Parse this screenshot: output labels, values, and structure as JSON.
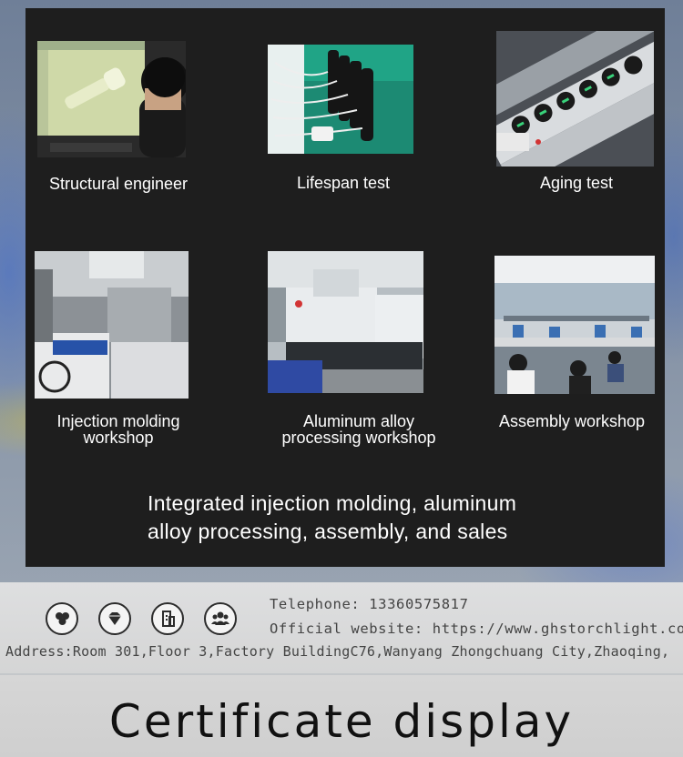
{
  "gallery": {
    "items": [
      {
        "caption": "Structural engineer",
        "icon": "cad-workstation-photo"
      },
      {
        "caption": "Lifespan test",
        "icon": "flashlight-test-photo"
      },
      {
        "caption": "Aging test",
        "icon": "aging-rack-photo"
      },
      {
        "caption": "Injection molding\nworkshop",
        "icon": "injection-machine-photo"
      },
      {
        "caption": "Aluminum alloy\nprocessing workshop",
        "icon": "cnc-machine-photo"
      },
      {
        "caption": "Assembly workshop",
        "icon": "assembly-line-photo"
      }
    ],
    "tagline_line1": "Integrated injection molding, aluminum",
    "tagline_line2": "alloy processing, assembly, and sales"
  },
  "contact": {
    "telephone": "Telephone: 13360575817",
    "website": "Official website: https://www.ghstorchlight.com",
    "address": "Address:Room 301,Floor 3,Factory BuildingC76,Wanyang Zhongchuang City,Zhaoqing,",
    "icons": [
      "users-icon",
      "diamond-icon",
      "building-icon",
      "group-icon"
    ]
  },
  "section": {
    "title": "Certificate display"
  },
  "colors": {
    "panel": "#1e1e1e",
    "text_light": "#ffffff",
    "text_dark": "#111111"
  }
}
